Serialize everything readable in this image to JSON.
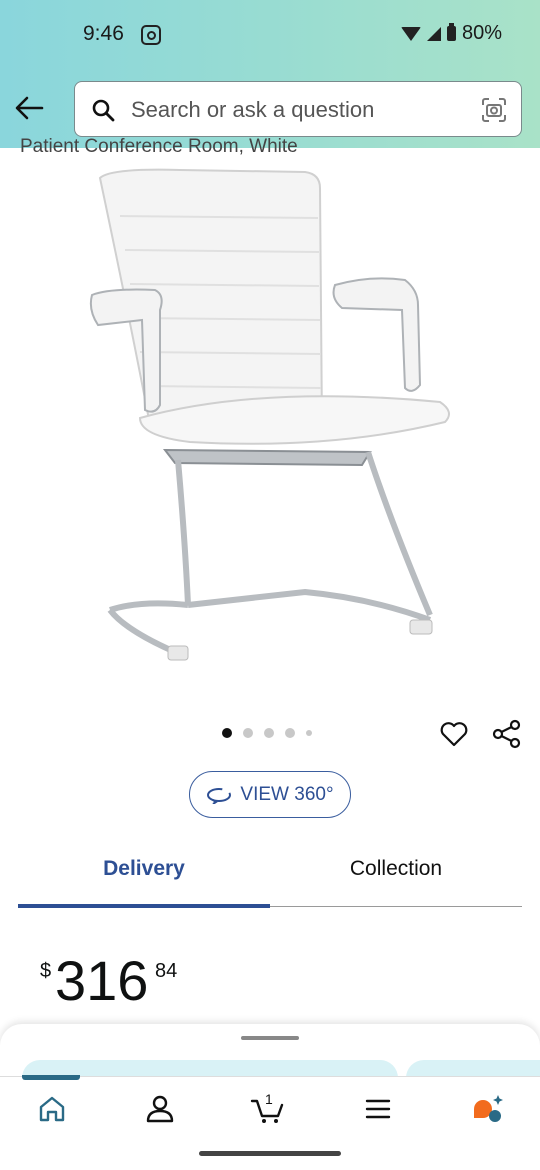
{
  "status_bar": {
    "time": "9:46",
    "battery": "80%"
  },
  "search": {
    "placeholder": "Search or ask a question"
  },
  "product": {
    "subtitle": "Patient Conference Room, White",
    "image_alt": "White ribbed office chair with chrome cantilever base and padded arms"
  },
  "carousel": {
    "total": 5,
    "active": 0
  },
  "view360": {
    "label": "VIEW 360°"
  },
  "tabs": {
    "delivery": "Delivery",
    "collection": "Collection",
    "selected": "Delivery"
  },
  "price": {
    "currency": "$",
    "whole": "316",
    "fraction": "84"
  },
  "bottom_nav": {
    "cart_count": "1",
    "active": "home"
  },
  "colors": {
    "accent": "#2d4f94",
    "header_start": "#8ad6dc",
    "header_end": "#a9e2c8",
    "nav_active": "#2a6a86",
    "rufus": "#f26b1d"
  }
}
